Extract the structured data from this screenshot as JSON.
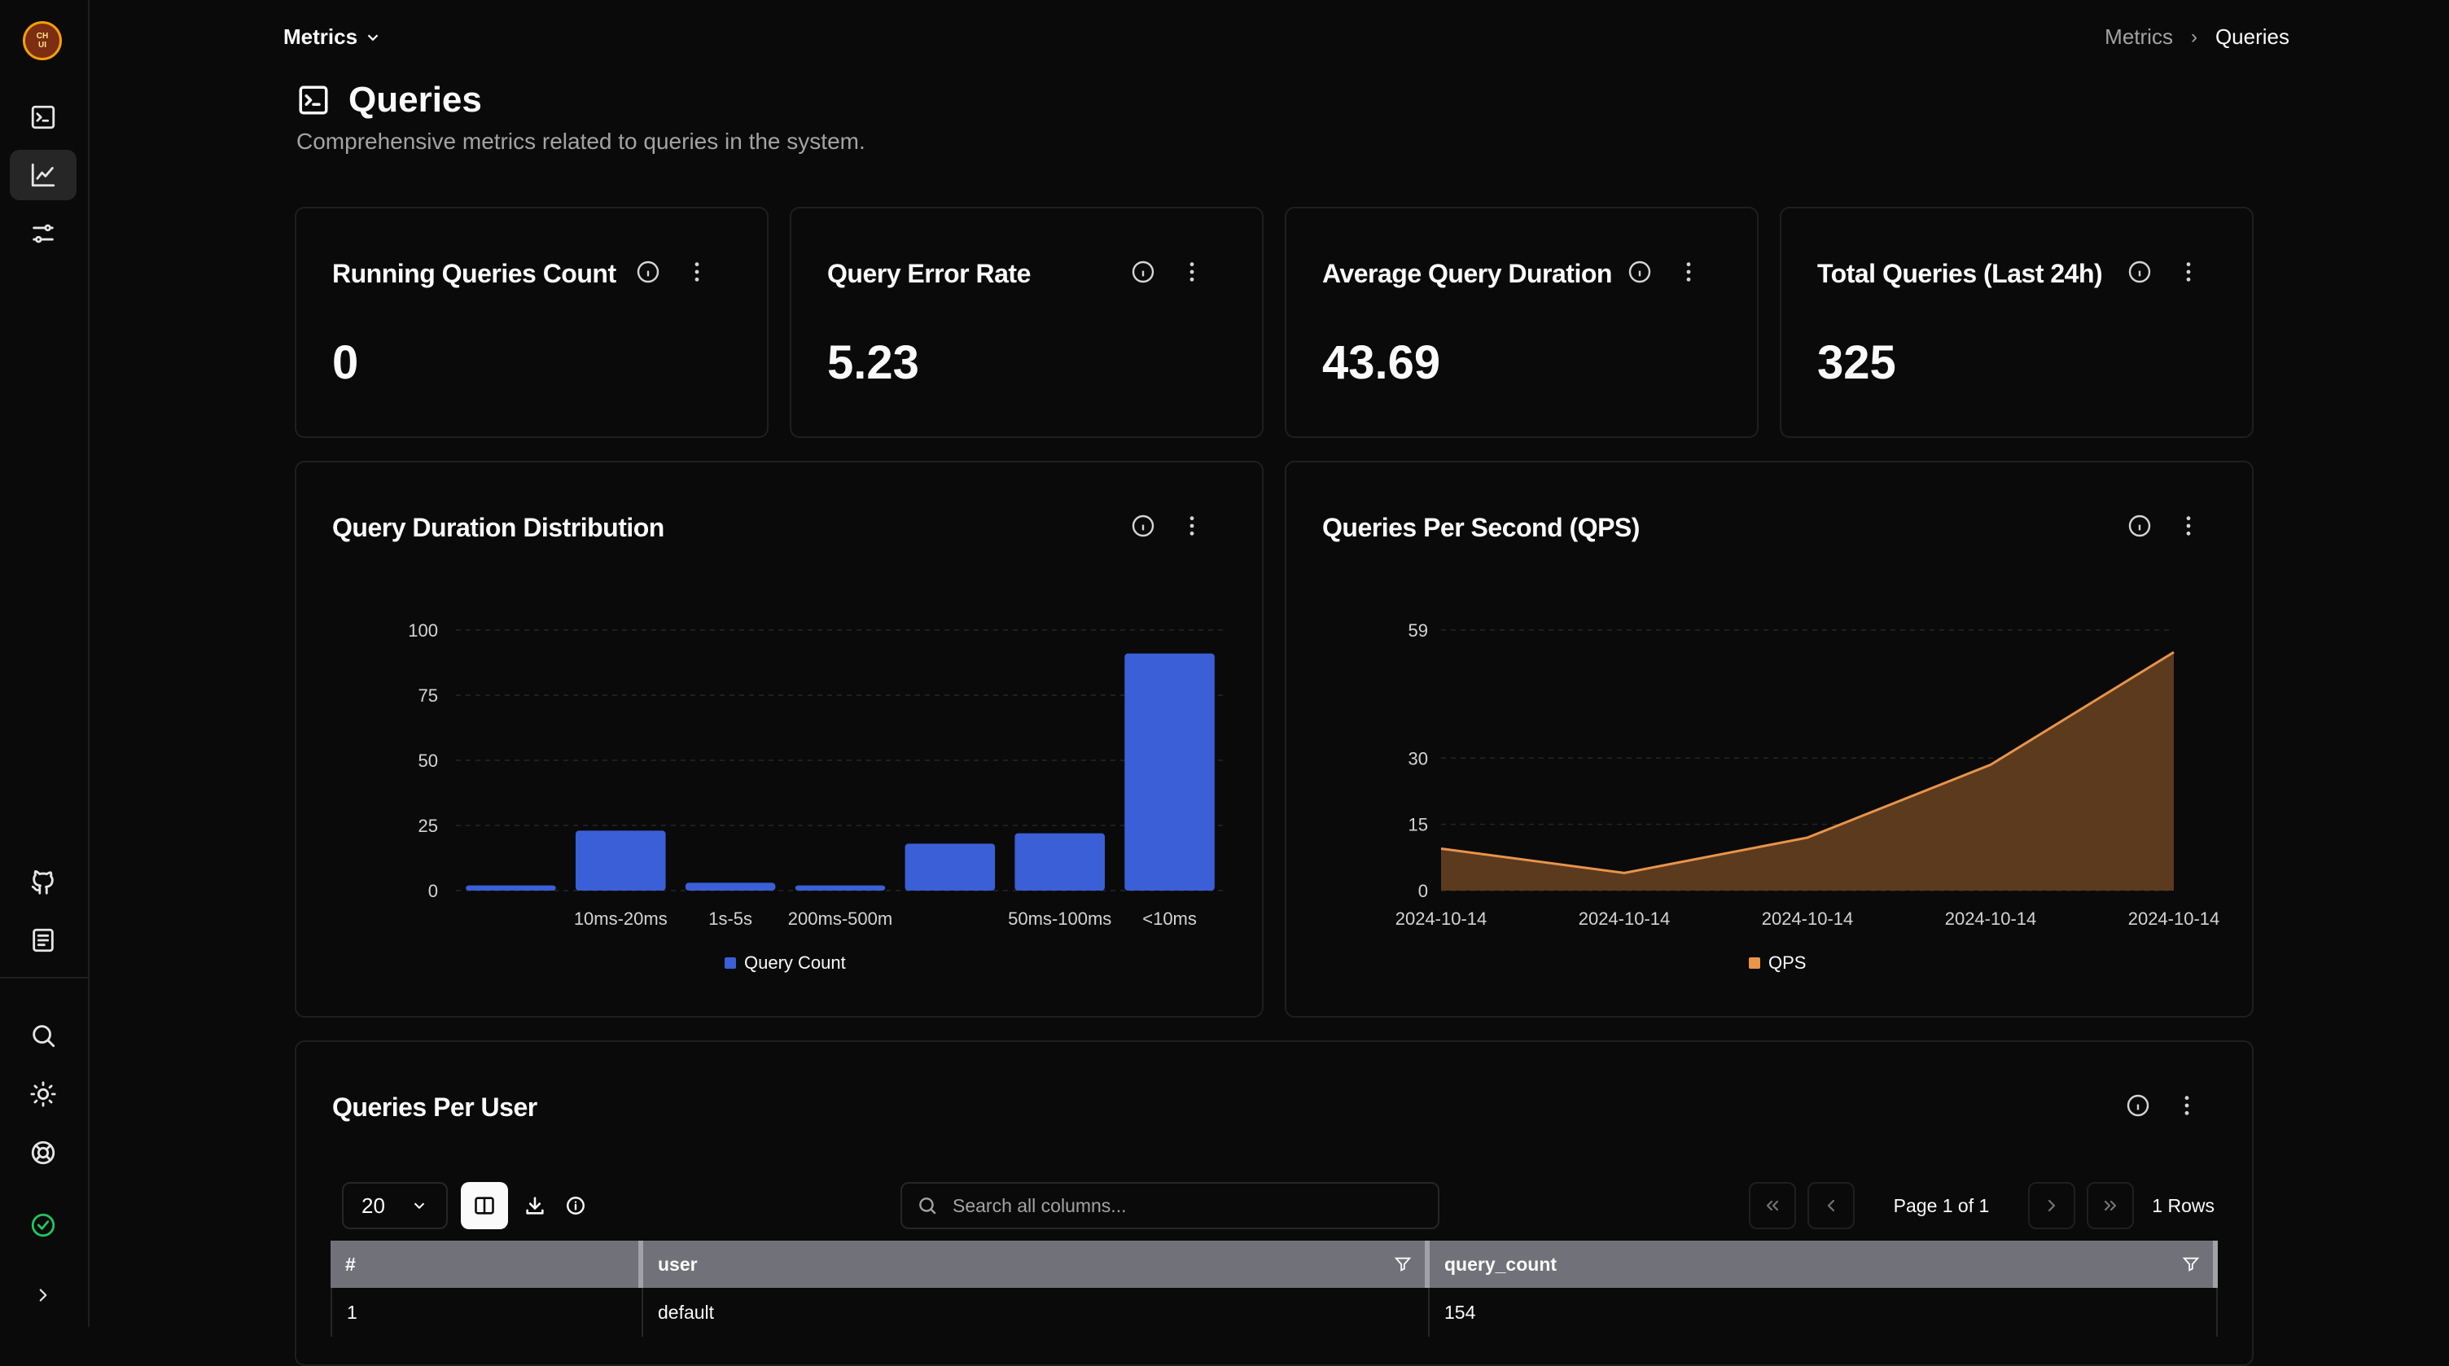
{
  "sidebar": {
    "logo_text": [
      "CH",
      "UI"
    ],
    "items": [
      "console-icon",
      "metrics-icon",
      "settings-sliders-icon",
      "github-icon",
      "docs-icon",
      "search-icon",
      "theme-icon",
      "help-icon",
      "status-icon",
      "expand-icon"
    ]
  },
  "topbar": {
    "menu_label": "Metrics"
  },
  "breadcrumb": {
    "parent": "Metrics",
    "current": "Queries"
  },
  "page": {
    "title": "Queries",
    "description": "Comprehensive metrics related to queries in the system."
  },
  "stats": [
    {
      "title": "Running Queries Count",
      "value": "0"
    },
    {
      "title": "Query Error Rate",
      "value": "5.23"
    },
    {
      "title": "Average Query Duration",
      "value": "43.69"
    },
    {
      "title": "Total Queries (Last 24h)",
      "value": "325"
    }
  ],
  "charts": {
    "duration": {
      "title": "Query Duration Distribution"
    },
    "qps": {
      "title": "Queries Per Second (QPS)"
    }
  },
  "chart_data": [
    {
      "type": "bar",
      "title": "Query Duration Distribution",
      "categories": [
        "",
        "10ms-20ms",
        "1s-5s",
        "200ms-500m",
        "",
        "50ms-100ms",
        "<10ms"
      ],
      "series": [
        {
          "name": "Query Count",
          "values": [
            2,
            23,
            3,
            2,
            18,
            22,
            91
          ],
          "color": "#3b5fd6"
        }
      ],
      "yticks": [
        0,
        25,
        50,
        75,
        100
      ],
      "ylim": [
        0,
        100
      ],
      "grid": true,
      "legend": "bottom"
    },
    {
      "type": "area",
      "title": "Queries Per Second (QPS)",
      "x": [
        "2024-10-14",
        "2024-10-14",
        "2024-10-14",
        "2024-10-14",
        "2024-10-14"
      ],
      "series": [
        {
          "name": "QPS",
          "values": [
            9.5,
            4,
            12,
            28.5,
            54
          ],
          "color": "#e8944a"
        }
      ],
      "yticks": [
        0,
        15,
        30,
        59
      ],
      "ylim": [
        0,
        59
      ],
      "grid": true,
      "legend": "bottom"
    }
  ],
  "table_card": {
    "title": "Queries Per User"
  },
  "table": {
    "page_size": "20",
    "search_placeholder": "Search all columns...",
    "page_info": "Page 1 of 1",
    "rows_info": "1 Rows",
    "columns": [
      "#",
      "user",
      "query_count"
    ],
    "rows": [
      [
        "1",
        "default",
        "154"
      ]
    ]
  }
}
